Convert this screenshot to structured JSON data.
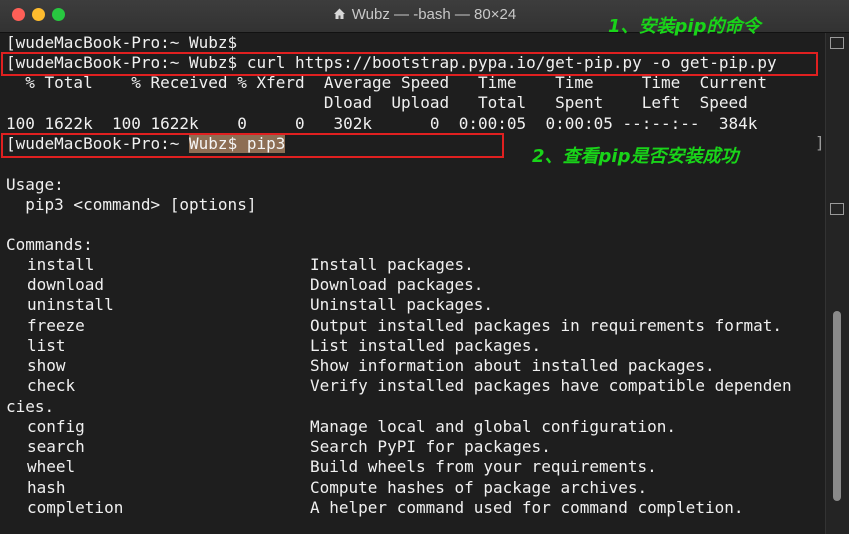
{
  "window": {
    "title": "Wubz — -bash — 80×24"
  },
  "prompt1": "[wudeMacBook-Pro:~ Wubz$",
  "curl_cmd": "[wudeMacBook-Pro:~ Wubz$ curl https://bootstrap.pypa.io/get-pip.py -o get-pip.py",
  "curl_header1": "  % Total    % Received % Xferd  Average Speed   Time    Time     Time  Current",
  "curl_header2": "                                 Dload  Upload   Total   Spent    Left  Speed",
  "curl_progress": "100 1622k  100 1622k    0     0   302k      0  0:00:05  0:00:05 --:--:--  384k",
  "prompt2": "[wudeMacBook-Pro:~ ",
  "pip3_cmd": "Wubz$ pip3",
  "usage_label": "Usage:",
  "usage_line": "  pip3 <command> [options]",
  "commands_label": "Commands:",
  "commands": [
    {
      "name": "install",
      "desc": "Install packages."
    },
    {
      "name": "download",
      "desc": "Download packages."
    },
    {
      "name": "uninstall",
      "desc": "Uninstall packages."
    },
    {
      "name": "freeze",
      "desc": "Output installed packages in requirements format."
    },
    {
      "name": "list",
      "desc": "List installed packages."
    },
    {
      "name": "show",
      "desc": "Show information about installed packages."
    },
    {
      "name": "check",
      "desc": "Verify installed packages have compatible dependen"
    },
    {
      "name": "config",
      "desc": "Manage local and global configuration."
    },
    {
      "name": "search",
      "desc": "Search PyPI for packages."
    },
    {
      "name": "wheel",
      "desc": "Build wheels from your requirements."
    },
    {
      "name": "hash",
      "desc": "Compute hashes of package archives."
    },
    {
      "name": "completion",
      "desc": "A helper command used for command completion."
    }
  ],
  "wrap_line": "cies.",
  "annotations": {
    "step1": "1、安装pip的命令",
    "step2": "2、查看pip是否安装成功"
  },
  "colors": {
    "annotation": "#19d419",
    "box": "#e02020",
    "highlight": "#8d6e54"
  }
}
